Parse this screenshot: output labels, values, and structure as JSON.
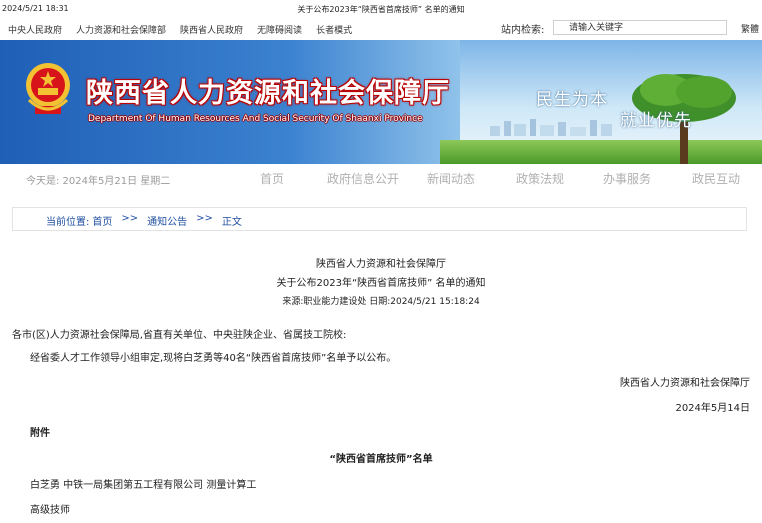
{
  "print_header": {
    "datetime": "2024/5/21 18:31",
    "page_title": "关于公布2023年“陕西省首席技师” 名单的通知"
  },
  "top_links": [
    "中央人民政府",
    "人力资源和社会保障部",
    "陕西省人民政府",
    "无障碍阅读",
    "长者模式"
  ],
  "search": {
    "label": "站内检索:",
    "placeholder": "请输入关键字"
  },
  "traditional_label": "繁體",
  "banner": {
    "title": "陕西省人力资源和社会保障厅",
    "subtitle": "Department Of Human Resources And Social Security Of Shaanxi Province",
    "slogan_1": "民生为本",
    "slogan_2": "就业优先",
    "emblem_icon": "national-emblem-icon"
  },
  "main_nav": {
    "date_text": "今天是: 2024年5月21日 星期二",
    "items": [
      "首页",
      "政府信息公开",
      "新闻动态",
      "政策法规",
      "办事服务",
      "政民互动"
    ]
  },
  "breadcrumb": {
    "label": "当前位置:",
    "items": [
      "首页",
      "通知公告",
      "正文"
    ],
    "separator": ">>"
  },
  "article": {
    "org": "陕西省人力资源和社会保障厅",
    "title": "关于公布2023年“陕西省首席技师” 名单的通知",
    "meta": "来源:职业能力建设处   日期:2024/5/21 15:18:24",
    "salutation": "各市(区)人力资源社会保障局,省直有关单位、中央驻陕企业、省属技工院校:",
    "body": "经省委人才工作领导小组审定,现将白芝勇等40名“陕西省首席技师”名单予以公布。",
    "signature": "陕西省人力资源和社会保障厅",
    "sign_date": "2024年5月14日",
    "attachment_label": "附件",
    "list_title": "“陕西省首席技师”名单",
    "entry_1": "白芝勇  中铁一局集团第五工程有限公司 测量计算工",
    "entry_1_level": "高级技师"
  },
  "colors": {
    "banner_blue": "#1f5fb6",
    "title_red": "#c00000",
    "link_blue": "#1f4fa0",
    "nav_gray": "#b0b0b0"
  }
}
